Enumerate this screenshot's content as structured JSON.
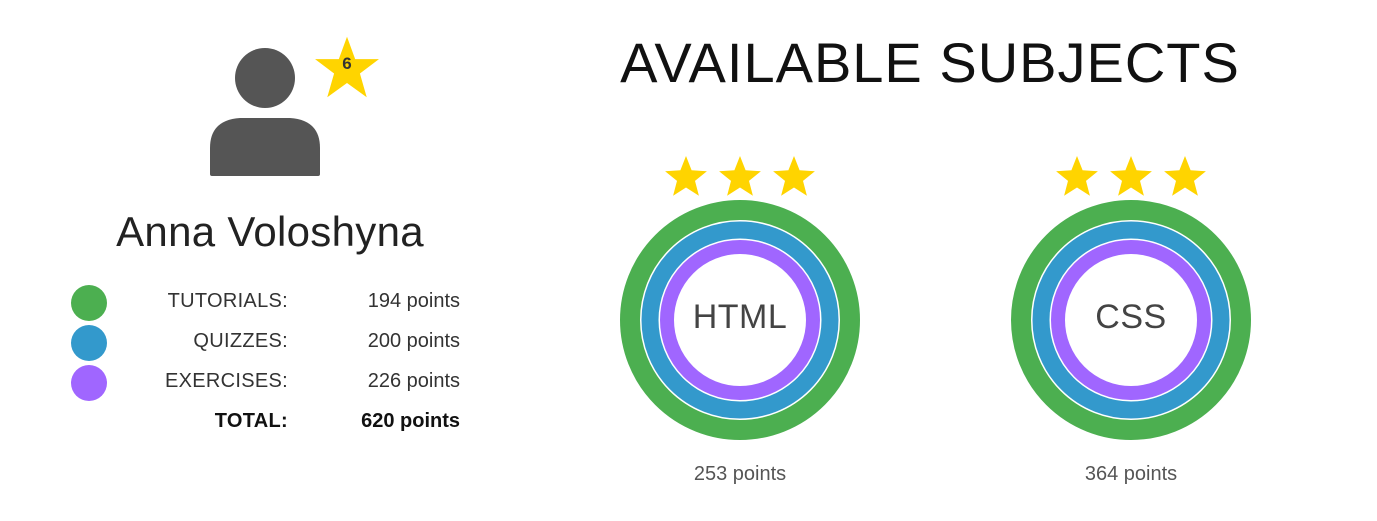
{
  "user": {
    "name": "Anna Voloshyna",
    "level": "6",
    "avatar_icon": "user-silhouette-icon",
    "level_icon": "star-icon"
  },
  "stats": [
    {
      "label": "TUTORIALS:",
      "value": "194 points",
      "color": "#4caf50"
    },
    {
      "label": "QUIZZES:",
      "value": "200 points",
      "color": "#3399cc"
    },
    {
      "label": "EXERCISES:",
      "value": "226 points",
      "color": "#a066ff"
    },
    {
      "label": "TOTAL:",
      "value": "620 points"
    }
  ],
  "subjects_title": "AVAILABLE SUBJECTS",
  "subjects": [
    {
      "name": "HTML",
      "points": "253 points",
      "stars": 3
    },
    {
      "name": "CSS",
      "points": "364 points",
      "stars": 3
    }
  ],
  "colors": {
    "star": "#ffd400",
    "tutorials": "#4caf50",
    "quizzes": "#3399cc",
    "exercises": "#a066ff",
    "avatar": "#555555"
  }
}
